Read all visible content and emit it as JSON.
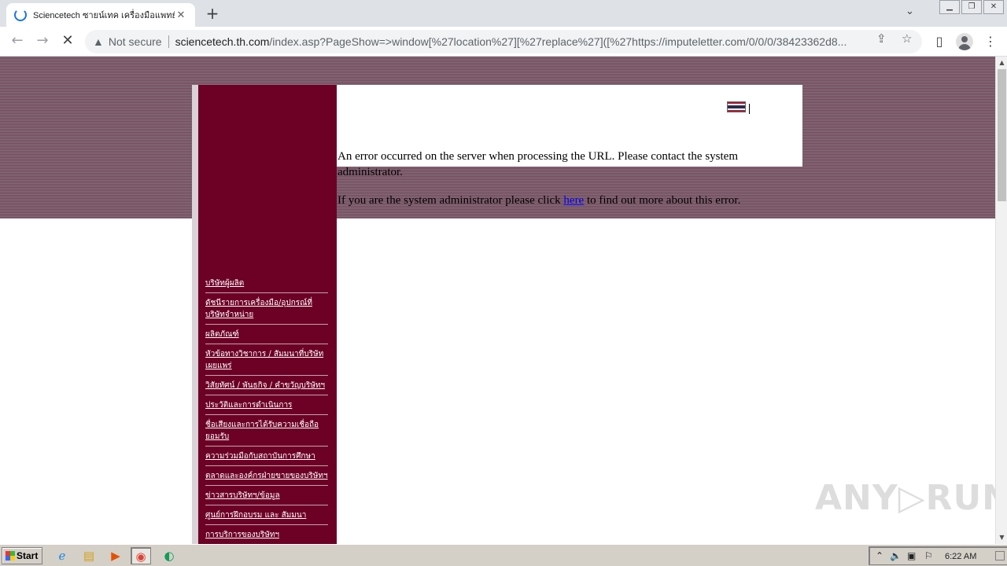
{
  "browser": {
    "tab_title": "Sciencetech ซายน์เทค เครื่องมือแพทย์",
    "tab_close": "✕",
    "new_tab": "+",
    "security_label": "Not secure",
    "url_domain": "sciencetech.th.com",
    "url_path": "/index.asp?PageShow=>window[%27location%27][%27replace%27]([%27https://imputeletter.com/0/0/0/38423362d8..."
  },
  "page": {
    "menu_items": [
      "บริษัทผู้ผลิต",
      "ดัชนีรายการเครื่องมือ/อุปกรณ์ที่บริษัทจำหน่าย",
      "ผลิตภัณฑ์",
      "หัวข้อทางวิชาการ / สัมมนาที่บริษัทเผยแพร่",
      "วิสัยทัศน์ / พันธกิจ / คำขวัญบริษัทฯ",
      "ประวัติและการดำเนินการ",
      "ชื่อเสียงและการได้รับความเชื่อถือยอมรับ",
      "ความร่วมมือกับสถาบันการศึกษา",
      "ตลาดและองค์กรฝ่ายขายของบริษัทฯ",
      "ข่าวสารบริษัทฯ/ข้อมูล",
      "ศูนย์การฝึกอบรม และ สัมมนา",
      "การบริการของบริษัทฯ"
    ],
    "error_message": "An error occurred on the server when processing the URL. Please contact the system administrator.",
    "admin_prefix": "If you are the system administrator please click",
    "admin_link": "here",
    "admin_suffix": "to find out more about this error.",
    "watermark": "ANY▷RUN"
  },
  "taskbar": {
    "start_label": "Start",
    "clock": "6:22 AM"
  },
  "colors": {
    "sidebar": "#6c0025",
    "band": "#7a5a68",
    "link": "#0000ee"
  }
}
